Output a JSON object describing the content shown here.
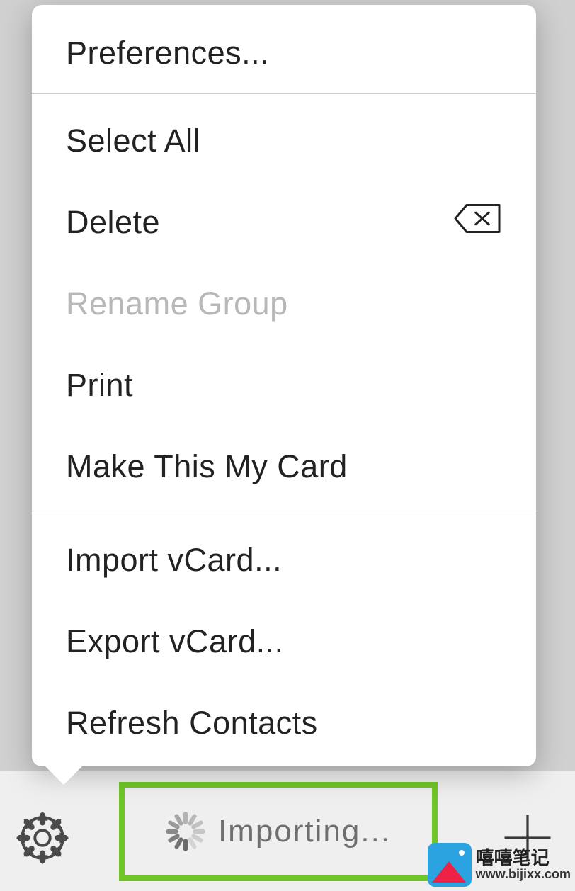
{
  "menu": {
    "preferences": "Preferences...",
    "select_all": "Select All",
    "delete": "Delete",
    "rename_group": "Rename Group",
    "print": "Print",
    "make_my_card": "Make This My Card",
    "import_vcard": "Import vCard...",
    "export_vcard": "Export vCard...",
    "refresh_contacts": "Refresh Contacts"
  },
  "toolbar": {
    "status_text": "Importing..."
  },
  "watermark": {
    "title": "嘻嘻笔记",
    "url": "www.bijixx.com"
  }
}
